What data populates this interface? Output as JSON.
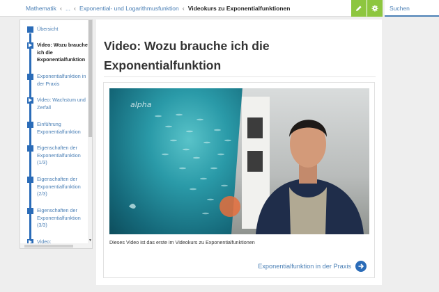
{
  "breadcrumb": {
    "items": [
      "Mathematik",
      "...",
      "Exponential- und Logarithmusfunktion"
    ],
    "current": "Videokurs zu Exponentialfunktionen"
  },
  "toolbar": {
    "edit_icon": "pencil-icon",
    "settings_icon": "gear-icon"
  },
  "search": {
    "label": "Suchen"
  },
  "sidebar": {
    "items": [
      {
        "label": "Übersicht",
        "marker": "square",
        "active": false
      },
      {
        "label": "Video: Wozu brauche ich die Exponentialfunktion",
        "marker": "play",
        "active": true
      },
      {
        "label": "Exponentialfunktion in der Praxis",
        "marker": "square",
        "active": false
      },
      {
        "label": "Video: Wachstum und Zerfall",
        "marker": "play",
        "active": false
      },
      {
        "label": "Einführung Exponentialfunktion",
        "marker": "square",
        "active": false
      },
      {
        "label": "Eigenschaften der Exponentialfunktion (1/3)",
        "marker": "square",
        "active": false
      },
      {
        "label": "Eigenschaften der Exponentialfunktion (2/3)",
        "marker": "square",
        "active": false
      },
      {
        "label": "Eigenschaften der Exponentialfunktion (3/3)",
        "marker": "square",
        "active": false
      },
      {
        "label": "Video:",
        "marker": "play",
        "active": false
      }
    ]
  },
  "main": {
    "title": "Video: Wozu brauche ich die Exponentialfunktion",
    "video": {
      "logo": "alpha"
    },
    "caption": "Dieses Video ist das erste im Videokurs zu Exponentialfunktionen",
    "next_link": "Exponentialfunktion in der Praxis"
  },
  "colors": {
    "accent": "#2b6cb8",
    "link": "#4a7fb5",
    "toolbar_green": "#8dc63f"
  }
}
